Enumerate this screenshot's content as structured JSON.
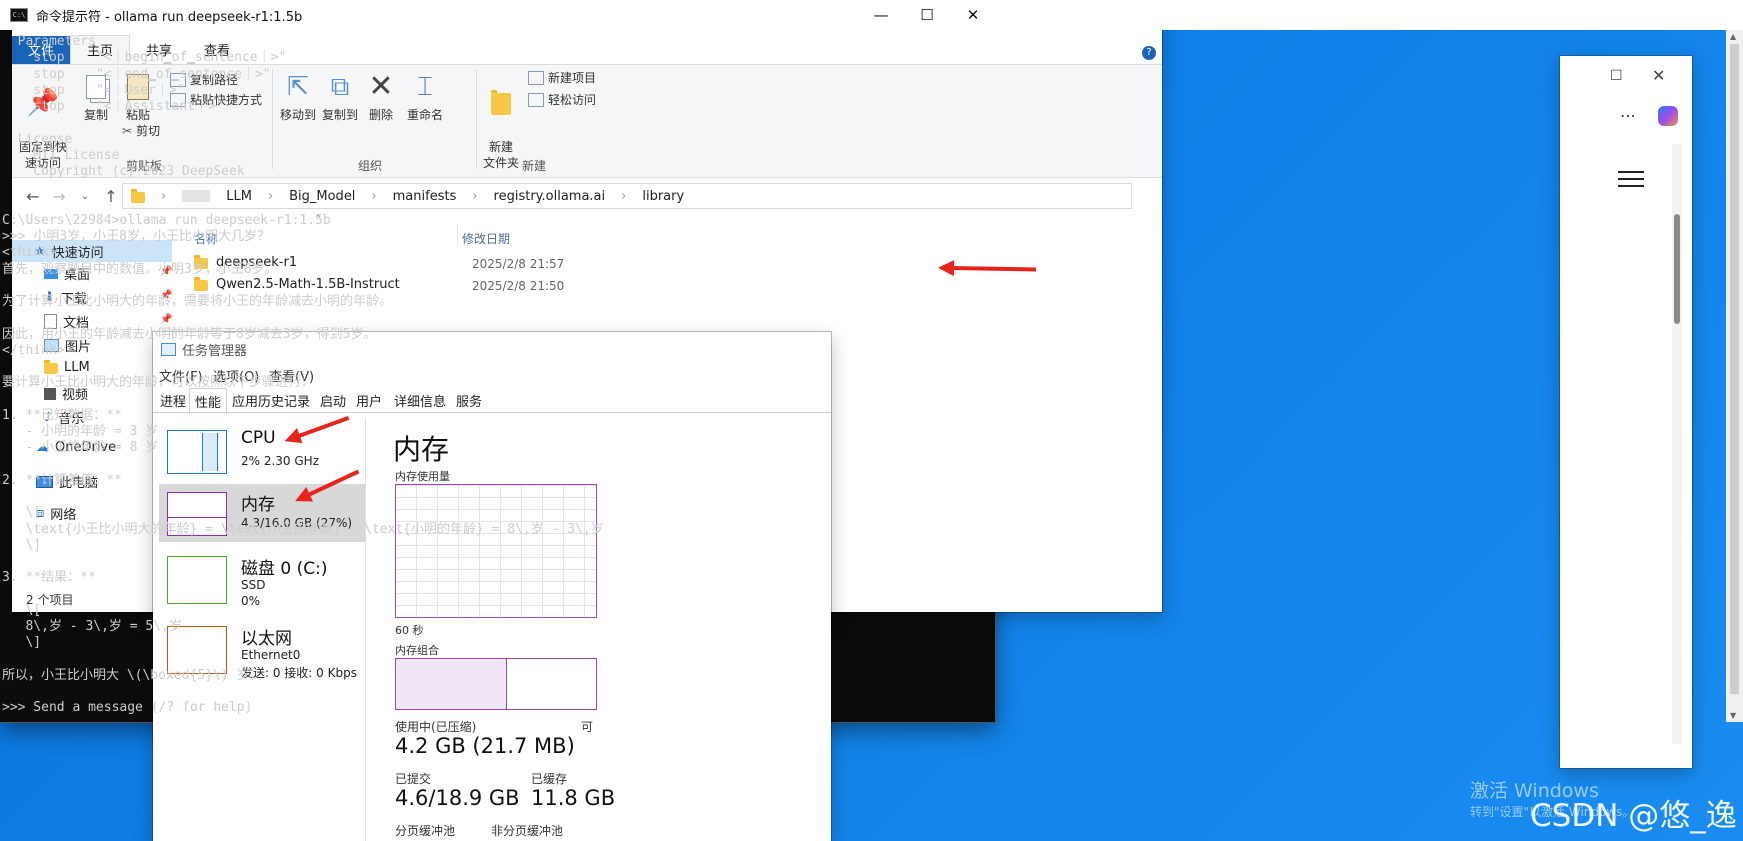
{
  "explorer": {
    "title": "library",
    "tabs": [
      "文件",
      "主页",
      "共享",
      "查看"
    ],
    "ribbon": {
      "pin": "固定到快\n速访问",
      "copy": "复制",
      "paste": "粘贴",
      "copy_path": "复制路径",
      "paste_shortcut": "粘贴快捷方式",
      "cut": "剪切",
      "group_clipboard": "剪贴板",
      "move_to": "移动到",
      "copy_to": "复制到",
      "delete": "删除",
      "rename": "重命名",
      "group_organize": "组织",
      "new_folder": "新建\n文件夹",
      "new_item": "新建项目",
      "easy_access": "轻松访问",
      "group_new": "新建"
    },
    "breadcrumb": [
      "LLM",
      "Big_Model",
      "manifests",
      "registry.ollama.ai",
      "library"
    ],
    "nav": {
      "quick_access": "快速访问",
      "items": [
        "桌面",
        "下载",
        "文档",
        "图片",
        "LLM",
        "视频",
        "音乐"
      ],
      "onedrive": "OneDrive",
      "this_pc": "此电脑",
      "network": "网络"
    },
    "columns": {
      "name": "名称",
      "modified": "修改日期"
    },
    "files": [
      {
        "name": "deepseek-r1",
        "date": "2025/2/8 21:57"
      },
      {
        "name": "Qwen2.5-Math-1.5B-Instruct",
        "date": "2025/2/8 21:50"
      }
    ],
    "status": "2 个项目"
  },
  "taskmgr": {
    "title": "任务管理器",
    "menu": [
      "文件(F)",
      "选项(O)",
      "查看(V)"
    ],
    "tabs": [
      "进程",
      "性能",
      "应用历史记录",
      "启动",
      "用户",
      "详细信息",
      "服务"
    ],
    "perf": [
      {
        "name": "CPU",
        "sub": "2% 2.30 GHz",
        "color": "#1a7bc8"
      },
      {
        "name": "内存",
        "sub": "4.3/16.0 GB (27%)",
        "color": "#8b2fb0"
      },
      {
        "name": "磁盘 0 (C:)",
        "sub": "SSD",
        "sub2": "0%",
        "color": "#4aa936"
      },
      {
        "name": "以太网",
        "sub": "Ethernet0",
        "sub2": "发送: 0 接收: 0 Kbps",
        "color": "#b65a1b"
      }
    ],
    "detail": {
      "heading": "内存",
      "usage_label": "内存使用量",
      "time_label": "60 秒",
      "composition_label": "内存组合",
      "in_use_label": "使用中(已压缩)",
      "in_use_value": "4.2 GB (21.7 MB)",
      "committed_label": "已提交",
      "committed_value": "4.6/18.9 GB",
      "cached_label": "已缓存",
      "cached_value": "11.8 GB",
      "paged_label": "分页缓冲池",
      "nonpaged_label": "非分页缓冲池",
      "cut_label": "可"
    }
  },
  "cmd": {
    "title": "命令提示符 - ollama  run deepseek-r1:1.5b",
    "lines": [
      "  Parameters",
      "    stop    \"<｜begin▁of▁sentence｜>\"",
      "    stop    \"<｜end▁of▁sentence｜>\"",
      "    stop    \"<｜User｜>\"",
      "    stop    \"<｜Assistant｜>\"",
      "",
      "  License",
      "    MIT License",
      "    Copyright (c) 2023 DeepSeek",
      "",
      "",
      "C:\\Users\\22984>ollama run deepseek-r1:1.5b",
      ">>> 小明3岁，小王8岁，小王比小明大几岁？",
      "<think>",
      "首先，观察题目中的数值。小明3岁，小王8岁。",
      "",
      "为了计算小王比小明大的年龄，需要将小王的年龄减去小明的年龄。",
      "",
      "因此，用小王的年龄减去小明的年龄等于8岁减去3岁，得到5岁。",
      "</think>",
      "",
      "要计算小王比小明大的年龄，可以按照以下步骤进行：",
      "",
      "1. **已知数据：**",
      "   - 小明的年龄 = 3 岁",
      "   - 小王的年龄 = 8 岁",
      "",
      "2. **计算差值：**",
      "",
      "   \\[",
      "   \\text{小王比小明大的年龄} = \\text{小王的年龄} - \\text{小明的年龄} = 8\\,岁 - 3\\,岁",
      "   \\]",
      "",
      "3. **结果：**",
      "",
      "   \\[",
      "   8\\,岁 - 3\\,岁 = 5\\,岁",
      "   \\]",
      "",
      "所以，小王比小明大 \\(\\boxed{5}\\) 岁。",
      "",
      ">>> Send a message (/? for help)"
    ]
  },
  "watermark": {
    "activate": "激活 Windows",
    "activate_sub": "转到\"设置\"以激活 Windows。",
    "csdn": "CSDN @悠_逸"
  },
  "colors": {
    "arrow": "#e8231c",
    "file_tab": "#1a64b8",
    "desktop": "#0f7ee6"
  }
}
